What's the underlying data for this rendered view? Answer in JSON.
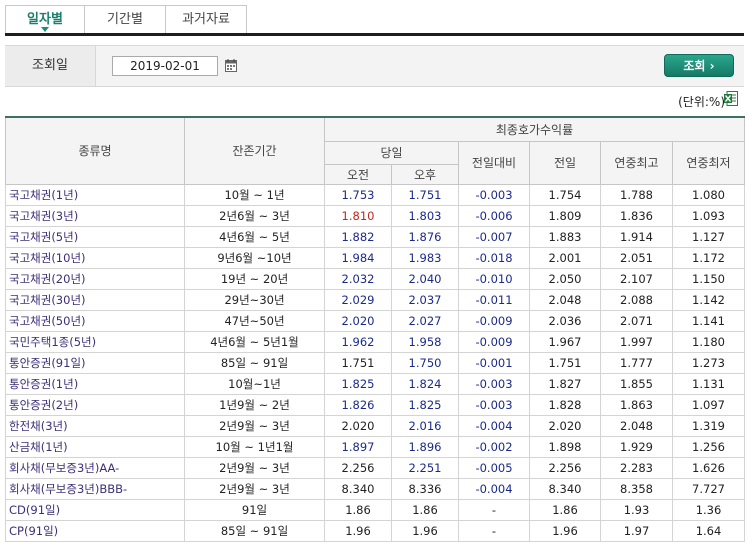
{
  "tabs": [
    {
      "label": "일자별",
      "active": true
    },
    {
      "label": "기간별",
      "active": false
    },
    {
      "label": "과거자료",
      "active": false
    }
  ],
  "search": {
    "label": "조회일",
    "date_value": "2019-02-01",
    "button_label": "조회 ›"
  },
  "unit_label": "(단위:%)",
  "colors": {
    "accent": "#1a8f7a",
    "button": "#1f8d77",
    "negative": "#1b2a8a",
    "highlight": "#c0291d"
  },
  "table": {
    "headers": {
      "type": "종류명",
      "term": "잔존기간",
      "group": "최종호가수익률",
      "today": "당일",
      "am": "오전",
      "pm": "오후",
      "change": "전일대비",
      "prev": "전일",
      "high": "연중최고",
      "low": "연중최저"
    },
    "rows": [
      {
        "name": "국고채권(1년)",
        "term": "10월 ~ 1년",
        "am": "1.753",
        "pm": "1.751",
        "change": "-0.003",
        "prev": "1.754",
        "high": "1.788",
        "low": "1.080"
      },
      {
        "name": "국고채권(3년)",
        "term": "2년6월 ~ 3년",
        "am": "1.810",
        "pm": "1.803",
        "change": "-0.006",
        "prev": "1.809",
        "high": "1.836",
        "low": "1.093"
      },
      {
        "name": "국고채권(5년)",
        "term": "4년6월 ~ 5년",
        "am": "1.882",
        "pm": "1.876",
        "change": "-0.007",
        "prev": "1.883",
        "high": "1.914",
        "low": "1.127"
      },
      {
        "name": "국고채권(10년)",
        "term": "9년6월 ~10년",
        "am": "1.984",
        "pm": "1.983",
        "change": "-0.018",
        "prev": "2.001",
        "high": "2.051",
        "low": "1.172"
      },
      {
        "name": "국고채권(20년)",
        "term": "19년 ~ 20년",
        "am": "2.032",
        "pm": "2.040",
        "change": "-0.010",
        "prev": "2.050",
        "high": "2.107",
        "low": "1.150"
      },
      {
        "name": "국고채권(30년)",
        "term": "29년~30년",
        "am": "2.029",
        "pm": "2.037",
        "change": "-0.011",
        "prev": "2.048",
        "high": "2.088",
        "low": "1.142"
      },
      {
        "name": "국고채권(50년)",
        "term": "47년~50년",
        "am": "2.020",
        "pm": "2.027",
        "change": "-0.009",
        "prev": "2.036",
        "high": "2.071",
        "low": "1.141"
      },
      {
        "name": "국민주택1종(5년)",
        "term": "4년6월 ~ 5년1월",
        "am": "1.962",
        "pm": "1.958",
        "change": "-0.009",
        "prev": "1.967",
        "high": "1.997",
        "low": "1.180"
      },
      {
        "name": "통안증권(91일)",
        "term": "85일 ~ 91일",
        "am": "1.751",
        "pm": "1.750",
        "change": "-0.001",
        "prev": "1.751",
        "high": "1.777",
        "low": "1.273"
      },
      {
        "name": "통안증권(1년)",
        "term": "10월~1년",
        "am": "1.825",
        "pm": "1.824",
        "change": "-0.003",
        "prev": "1.827",
        "high": "1.855",
        "low": "1.131"
      },
      {
        "name": "통안증권(2년)",
        "term": "1년9월 ~ 2년",
        "am": "1.826",
        "pm": "1.825",
        "change": "-0.003",
        "prev": "1.828",
        "high": "1.863",
        "low": "1.097"
      },
      {
        "name": "한전채(3년)",
        "term": "2년9월 ~ 3년",
        "am": "2.020",
        "pm": "2.016",
        "change": "-0.004",
        "prev": "2.020",
        "high": "2.048",
        "low": "1.319"
      },
      {
        "name": "산금채(1년)",
        "term": "10월 ~ 1년1월",
        "am": "1.897",
        "pm": "1.896",
        "change": "-0.002",
        "prev": "1.898",
        "high": "1.929",
        "low": "1.256"
      },
      {
        "name": "회사채(무보증3년)AA-",
        "term": "2년9월 ~ 3년",
        "am": "2.256",
        "pm": "2.251",
        "change": "-0.005",
        "prev": "2.256",
        "high": "2.283",
        "low": "1.626"
      },
      {
        "name": "회사채(무보증3년)BBB-",
        "term": "2년9월 ~ 3년",
        "am": "8.340",
        "pm": "8.336",
        "change": "-0.004",
        "prev": "8.340",
        "high": "8.358",
        "low": "7.727"
      },
      {
        "name": "CD(91일)",
        "term": "91일",
        "am": "1.86",
        "pm": "1.86",
        "change": "-",
        "prev": "1.86",
        "high": "1.93",
        "low": "1.36"
      },
      {
        "name": "CP(91일)",
        "term": "85일 ~ 91일",
        "am": "1.96",
        "pm": "1.96",
        "change": "-",
        "prev": "1.96",
        "high": "1.97",
        "low": "1.64"
      }
    ]
  }
}
